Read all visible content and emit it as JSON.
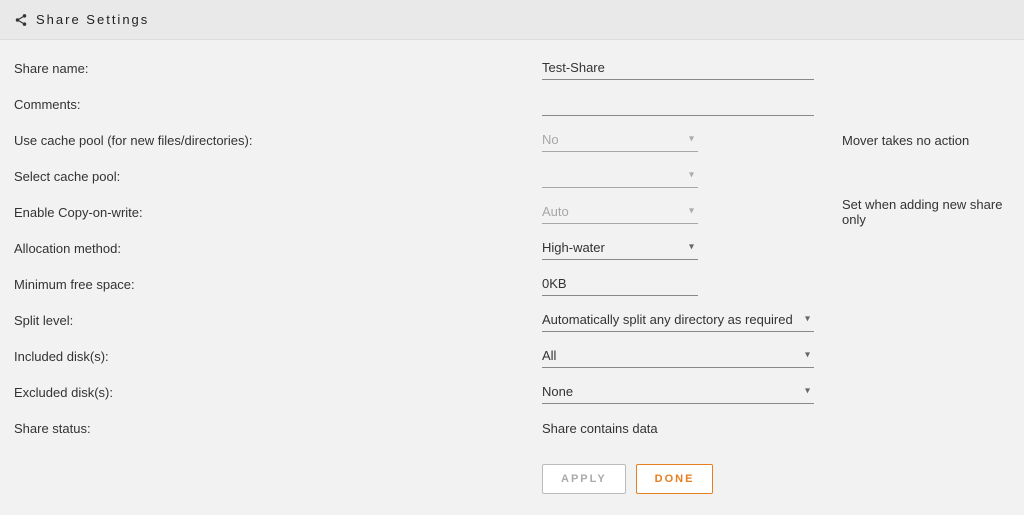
{
  "header": {
    "title": "Share Settings"
  },
  "rows": {
    "share_name": {
      "label": "Share name:",
      "value": "Test-Share"
    },
    "comments": {
      "label": "Comments:",
      "value": ""
    },
    "use_cache": {
      "label": "Use cache pool (for new files/directories):",
      "value": "No",
      "hint": "Mover takes no action"
    },
    "select_cache": {
      "label": "Select cache pool:",
      "value": ""
    },
    "cow": {
      "label": "Enable Copy-on-write:",
      "value": "Auto",
      "hint": "Set when adding new share only"
    },
    "allocation": {
      "label": "Allocation method:",
      "value": "High-water"
    },
    "min_free": {
      "label": "Minimum free space:",
      "value": "0KB"
    },
    "split": {
      "label": "Split level:",
      "value": "Automatically split any directory as required"
    },
    "included": {
      "label": "Included disk(s):",
      "value": "All"
    },
    "excluded": {
      "label": "Excluded disk(s):",
      "value": "None"
    },
    "status": {
      "label": "Share status:",
      "value": "Share contains data"
    }
  },
  "buttons": {
    "apply": "APPLY",
    "done": "DONE"
  }
}
